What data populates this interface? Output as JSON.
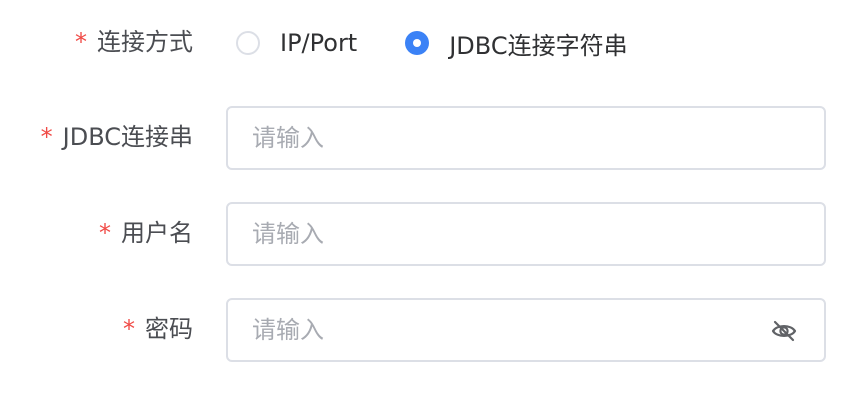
{
  "form": {
    "connection_method": {
      "required_mark": "*",
      "label": "连接方式",
      "options": [
        {
          "label": "IP/Port",
          "checked": false
        },
        {
          "label": "JDBC连接字符串",
          "checked": true
        }
      ]
    },
    "jdbc": {
      "required_mark": "*",
      "label": "JDBC连接串",
      "value": "",
      "placeholder": "请输入"
    },
    "username": {
      "required_mark": "*",
      "label": "用户名",
      "value": "",
      "placeholder": "请输入"
    },
    "password": {
      "required_mark": "*",
      "label": "密码",
      "value": "",
      "placeholder": "请输入",
      "toggle_icon": "eye-slash-icon"
    }
  },
  "colors": {
    "required": "#f04a46",
    "accent": "#3b82f6",
    "border": "#dcdfe6",
    "placeholder": "#a8abb2"
  }
}
